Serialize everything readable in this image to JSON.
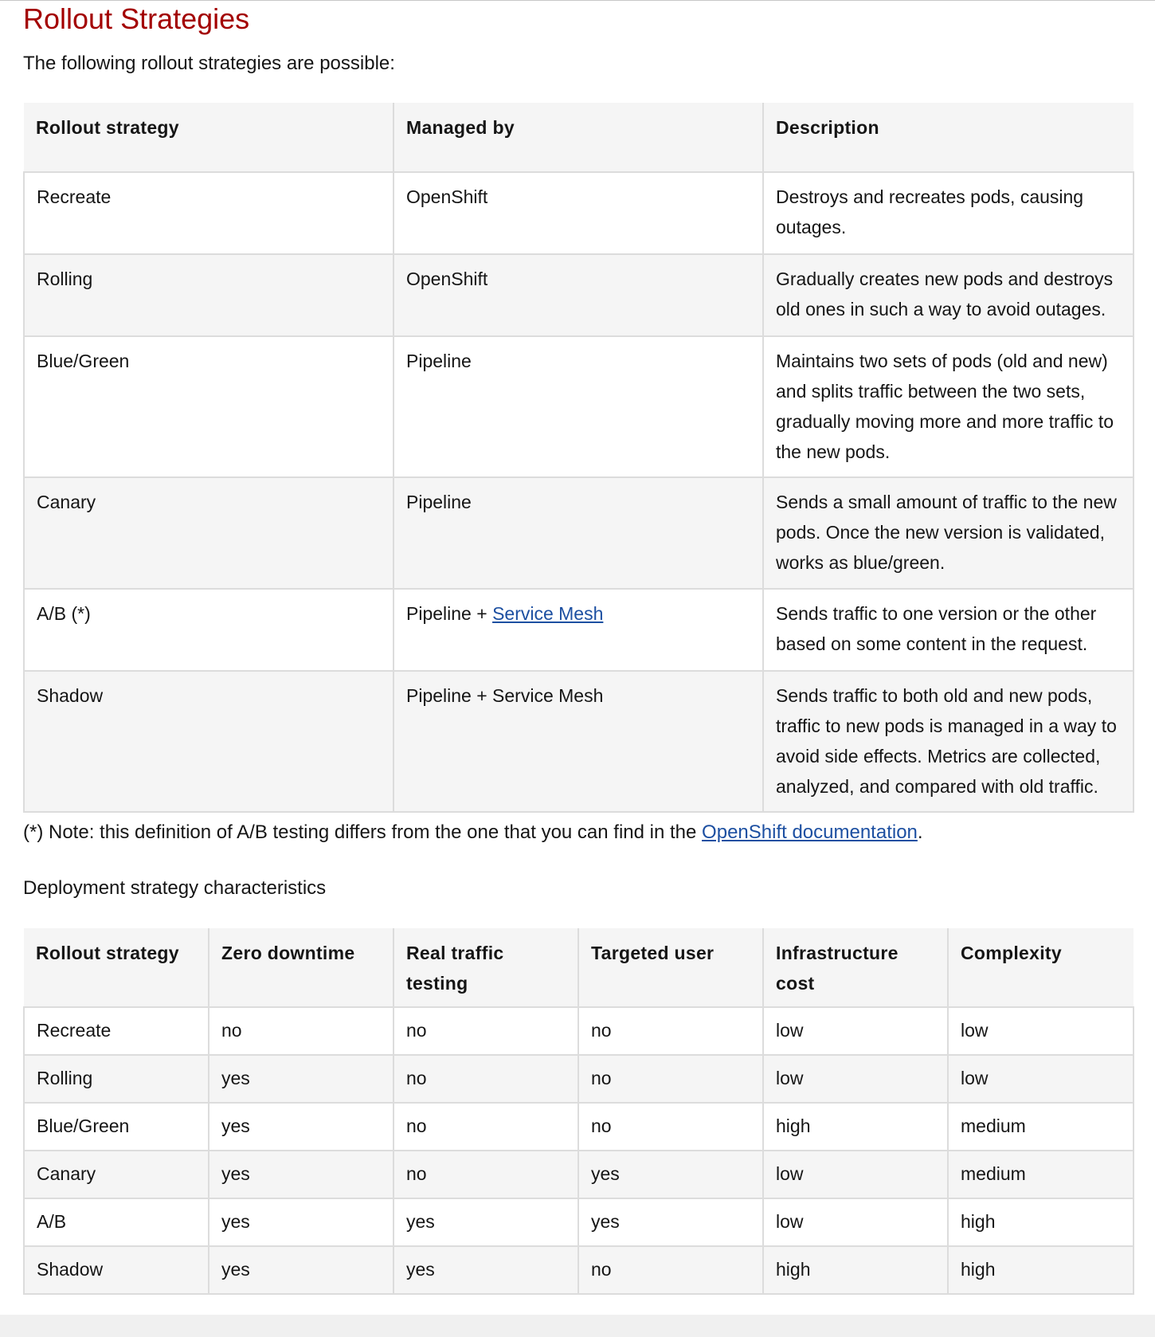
{
  "section_title": "Rollout Strategies",
  "intro": "The following rollout strategies are possible:",
  "strategies_table": {
    "headers": [
      "Rollout strategy",
      "Managed by",
      "Description"
    ],
    "rows": [
      {
        "strategy": "Recreate",
        "managed_by": "OpenShift",
        "description": "Destroys and recreates pods, causing outages."
      },
      {
        "strategy": "Rolling",
        "managed_by": "OpenShift",
        "description": "Gradually creates new pods and destroys old ones in such a way to avoid outages."
      },
      {
        "strategy": "Blue/Green",
        "managed_by": "Pipeline",
        "description": "Maintains two sets of pods (old and new) and splits traffic between the two sets, gradually moving more and more traffic to the new pods."
      },
      {
        "strategy": "Canary",
        "managed_by": "Pipeline",
        "description": "Sends a small amount of traffic to the new pods. Once the new version is validated, works as blue/green."
      },
      {
        "strategy": "A/B (*)",
        "managed_by_prefix": "Pipeline + ",
        "managed_by_link": "Service Mesh",
        "description": "Sends traffic to one version or the other based on some content in the request."
      },
      {
        "strategy": "Shadow",
        "managed_by": "Pipeline + Service Mesh",
        "description": "Sends traffic to both old and new pods, traffic to new pods is managed in a way to avoid side effects. Metrics are collected, analyzed, and compared with old traffic."
      }
    ]
  },
  "note": {
    "text": "(*) Note: this definition of A/B testing differs from the one that you can find in the ",
    "link": "OpenShift documentation",
    "suffix": "."
  },
  "characteristics_caption": "Deployment strategy characteristics",
  "characteristics_table": {
    "headers": [
      "Rollout strategy",
      "Zero downtime",
      "Real traffic testing",
      "Targeted user",
      "Infrastructure cost",
      "Complexity"
    ],
    "rows": [
      [
        "Recreate",
        "no",
        "no",
        "no",
        "low",
        "low"
      ],
      [
        "Rolling",
        "yes",
        "no",
        "no",
        "low",
        "low"
      ],
      [
        "Blue/Green",
        "yes",
        "no",
        "no",
        "high",
        "medium"
      ],
      [
        "Canary",
        "yes",
        "no",
        "yes",
        "low",
        "medium"
      ],
      [
        "A/B",
        "yes",
        "yes",
        "yes",
        "low",
        "high"
      ],
      [
        "Shadow",
        "yes",
        "yes",
        "no",
        "high",
        "high"
      ]
    ]
  },
  "colors": {
    "title": "#a30000",
    "link": "#1c4fa1",
    "header_bg": "#f5f5f5",
    "border": "#dcdcdc"
  }
}
